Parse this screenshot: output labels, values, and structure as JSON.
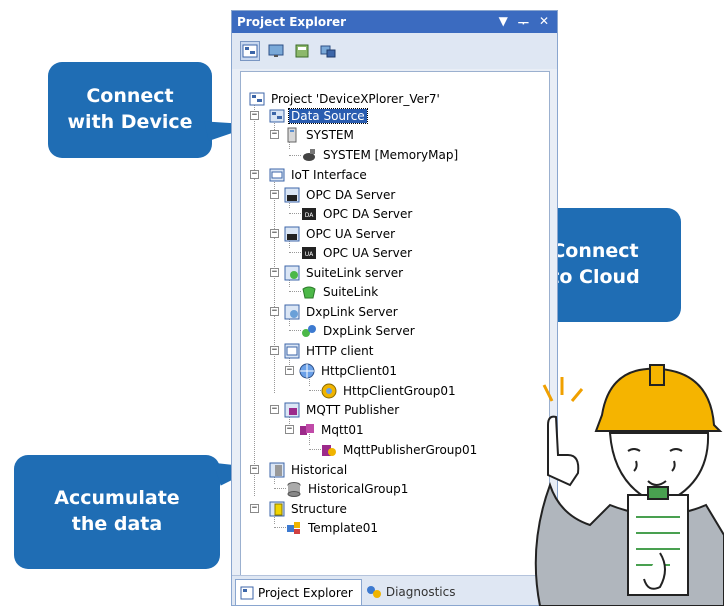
{
  "panel": {
    "title": "Project Explorer",
    "controls": [
      "▼",
      "ᅮ",
      "✕"
    ]
  },
  "tree": {
    "project": "Project 'DeviceXPlorer_Ver7'",
    "data_source": "Data Source",
    "system": "SYSTEM",
    "system_memmap": "SYSTEM [MemoryMap]",
    "iot_interface": "IoT Interface",
    "opc_da_server": "OPC DA Server",
    "opc_da_server_child": "OPC DA Server",
    "opc_ua_server": "OPC UA Server",
    "opc_ua_server_child": "OPC UA Server",
    "suitelink_server": "SuiteLink server",
    "suitelink": "SuiteLink",
    "dxplink_server": "DxpLink Server",
    "dxplink_server_child": "DxpLink Server",
    "http_client": "HTTP client",
    "httpclient01": "HttpClient01",
    "httpclientgroup01": "HttpClientGroup01",
    "mqtt_publisher": "MQTT Publisher",
    "mqtt01": "Mqtt01",
    "mqttpublishergroup01": "MqttPublisherGroup01",
    "historical": "Historical",
    "historicalgroup1": "HistoricalGroup1",
    "structure": "Structure",
    "template01": "Template01"
  },
  "tabs": {
    "project_explorer": "Project Explorer",
    "diagnostics": "Diagnostics"
  },
  "callouts": {
    "connect_device": "Connect\nwith Device",
    "connect_cloud": "Connect\nto Cloud",
    "accumulate": "Accumulate\nthe data"
  },
  "colors": {
    "bubble": "#1f6db4",
    "titlebar": "#3b6bc0",
    "selection": "#2a5db0"
  }
}
